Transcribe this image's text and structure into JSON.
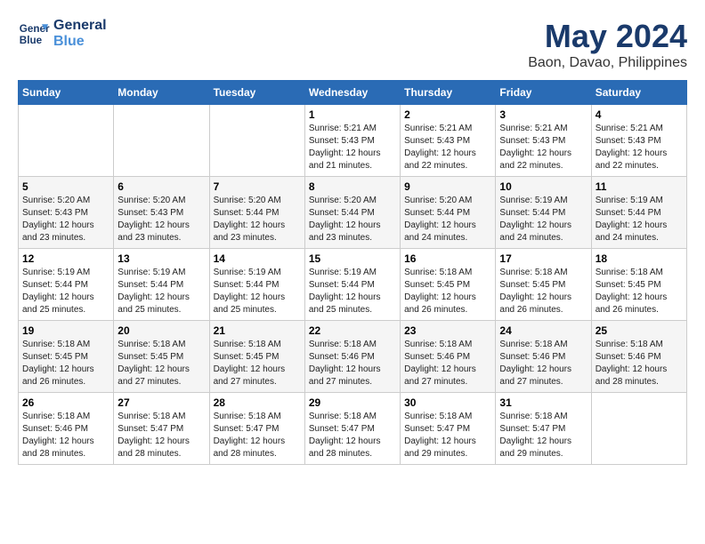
{
  "logo": {
    "line1": "General",
    "line2": "Blue"
  },
  "title": "May 2024",
  "subtitle": "Baon, Davao, Philippines",
  "days_header": [
    "Sunday",
    "Monday",
    "Tuesday",
    "Wednesday",
    "Thursday",
    "Friday",
    "Saturday"
  ],
  "weeks": [
    [
      {
        "day": "",
        "info": ""
      },
      {
        "day": "",
        "info": ""
      },
      {
        "day": "",
        "info": ""
      },
      {
        "day": "1",
        "info": "Sunrise: 5:21 AM\nSunset: 5:43 PM\nDaylight: 12 hours\nand 21 minutes."
      },
      {
        "day": "2",
        "info": "Sunrise: 5:21 AM\nSunset: 5:43 PM\nDaylight: 12 hours\nand 22 minutes."
      },
      {
        "day": "3",
        "info": "Sunrise: 5:21 AM\nSunset: 5:43 PM\nDaylight: 12 hours\nand 22 minutes."
      },
      {
        "day": "4",
        "info": "Sunrise: 5:21 AM\nSunset: 5:43 PM\nDaylight: 12 hours\nand 22 minutes."
      }
    ],
    [
      {
        "day": "5",
        "info": "Sunrise: 5:20 AM\nSunset: 5:43 PM\nDaylight: 12 hours\nand 23 minutes."
      },
      {
        "day": "6",
        "info": "Sunrise: 5:20 AM\nSunset: 5:43 PM\nDaylight: 12 hours\nand 23 minutes."
      },
      {
        "day": "7",
        "info": "Sunrise: 5:20 AM\nSunset: 5:44 PM\nDaylight: 12 hours\nand 23 minutes."
      },
      {
        "day": "8",
        "info": "Sunrise: 5:20 AM\nSunset: 5:44 PM\nDaylight: 12 hours\nand 23 minutes."
      },
      {
        "day": "9",
        "info": "Sunrise: 5:20 AM\nSunset: 5:44 PM\nDaylight: 12 hours\nand 24 minutes."
      },
      {
        "day": "10",
        "info": "Sunrise: 5:19 AM\nSunset: 5:44 PM\nDaylight: 12 hours\nand 24 minutes."
      },
      {
        "day": "11",
        "info": "Sunrise: 5:19 AM\nSunset: 5:44 PM\nDaylight: 12 hours\nand 24 minutes."
      }
    ],
    [
      {
        "day": "12",
        "info": "Sunrise: 5:19 AM\nSunset: 5:44 PM\nDaylight: 12 hours\nand 25 minutes."
      },
      {
        "day": "13",
        "info": "Sunrise: 5:19 AM\nSunset: 5:44 PM\nDaylight: 12 hours\nand 25 minutes."
      },
      {
        "day": "14",
        "info": "Sunrise: 5:19 AM\nSunset: 5:44 PM\nDaylight: 12 hours\nand 25 minutes."
      },
      {
        "day": "15",
        "info": "Sunrise: 5:19 AM\nSunset: 5:44 PM\nDaylight: 12 hours\nand 25 minutes."
      },
      {
        "day": "16",
        "info": "Sunrise: 5:18 AM\nSunset: 5:45 PM\nDaylight: 12 hours\nand 26 minutes."
      },
      {
        "day": "17",
        "info": "Sunrise: 5:18 AM\nSunset: 5:45 PM\nDaylight: 12 hours\nand 26 minutes."
      },
      {
        "day": "18",
        "info": "Sunrise: 5:18 AM\nSunset: 5:45 PM\nDaylight: 12 hours\nand 26 minutes."
      }
    ],
    [
      {
        "day": "19",
        "info": "Sunrise: 5:18 AM\nSunset: 5:45 PM\nDaylight: 12 hours\nand 26 minutes."
      },
      {
        "day": "20",
        "info": "Sunrise: 5:18 AM\nSunset: 5:45 PM\nDaylight: 12 hours\nand 27 minutes."
      },
      {
        "day": "21",
        "info": "Sunrise: 5:18 AM\nSunset: 5:45 PM\nDaylight: 12 hours\nand 27 minutes."
      },
      {
        "day": "22",
        "info": "Sunrise: 5:18 AM\nSunset: 5:46 PM\nDaylight: 12 hours\nand 27 minutes."
      },
      {
        "day": "23",
        "info": "Sunrise: 5:18 AM\nSunset: 5:46 PM\nDaylight: 12 hours\nand 27 minutes."
      },
      {
        "day": "24",
        "info": "Sunrise: 5:18 AM\nSunset: 5:46 PM\nDaylight: 12 hours\nand 27 minutes."
      },
      {
        "day": "25",
        "info": "Sunrise: 5:18 AM\nSunset: 5:46 PM\nDaylight: 12 hours\nand 28 minutes."
      }
    ],
    [
      {
        "day": "26",
        "info": "Sunrise: 5:18 AM\nSunset: 5:46 PM\nDaylight: 12 hours\nand 28 minutes."
      },
      {
        "day": "27",
        "info": "Sunrise: 5:18 AM\nSunset: 5:47 PM\nDaylight: 12 hours\nand 28 minutes."
      },
      {
        "day": "28",
        "info": "Sunrise: 5:18 AM\nSunset: 5:47 PM\nDaylight: 12 hours\nand 28 minutes."
      },
      {
        "day": "29",
        "info": "Sunrise: 5:18 AM\nSunset: 5:47 PM\nDaylight: 12 hours\nand 28 minutes."
      },
      {
        "day": "30",
        "info": "Sunrise: 5:18 AM\nSunset: 5:47 PM\nDaylight: 12 hours\nand 29 minutes."
      },
      {
        "day": "31",
        "info": "Sunrise: 5:18 AM\nSunset: 5:47 PM\nDaylight: 12 hours\nand 29 minutes."
      },
      {
        "day": "",
        "info": ""
      }
    ]
  ]
}
